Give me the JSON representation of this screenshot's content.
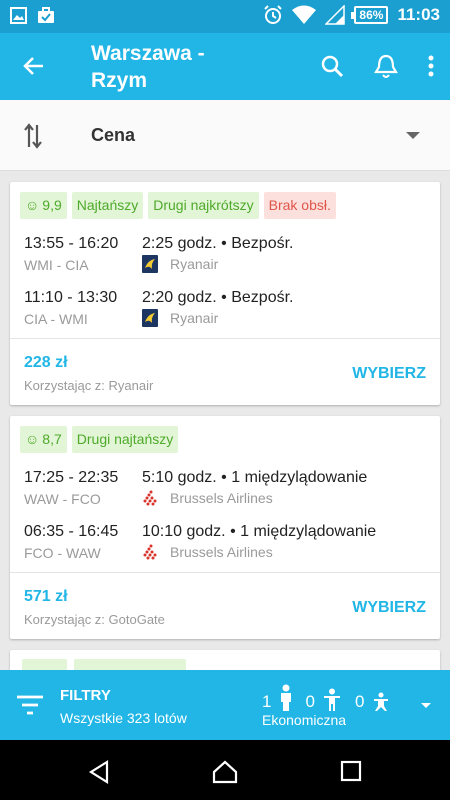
{
  "status": {
    "battery": "86%",
    "time": "11:03"
  },
  "appbar": {
    "title": "Warszawa - Rzym"
  },
  "sort": {
    "label": "Cena"
  },
  "results": [
    {
      "badges": [
        {
          "label": "9,9",
          "kind": "green",
          "smile": true
        },
        {
          "label": "Najtańszy",
          "kind": "green"
        },
        {
          "label": "Drugi najkrótszy",
          "kind": "green"
        },
        {
          "label": "Brak obsł.",
          "kind": "red"
        }
      ],
      "legs": [
        {
          "times": "13:55 - 16:20",
          "airports": "WMI - CIA",
          "duration": "2:25 godz. • Bezpośr.",
          "airline": "Ryanair"
        },
        {
          "times": "11:10 - 13:30",
          "airports": "CIA - WMI",
          "duration": "2:20 godz. • Bezpośr.",
          "airline": "Ryanair"
        }
      ],
      "price": "228 zł",
      "via": "Korzystając z: Ryanair",
      "select": "WYBIERZ"
    },
    {
      "badges": [
        {
          "label": "8,7",
          "kind": "green",
          "smile": true
        },
        {
          "label": "Drugi najtańszy",
          "kind": "green"
        }
      ],
      "legs": [
        {
          "times": "17:25 - 22:35",
          "airports": "WAW - FCO",
          "duration": "5:10 godz. • 1 międzylądowanie",
          "airline": "Brussels Airlines"
        },
        {
          "times": "06:35 - 16:45",
          "airports": "FCO - WAW",
          "duration": "10:10 godz. • 1 międzylądowanie",
          "airline": "Brussels Airlines"
        }
      ],
      "price": "571 zł",
      "via": "Korzystając z: GotoGate",
      "select": "WYBIERZ"
    }
  ],
  "bottombar": {
    "filter_title": "FILTRY",
    "filter_sub": "Wszystkie 323 lotów",
    "adults": "1",
    "children": "0",
    "infants": "0",
    "cabin": "Ekonomiczna"
  }
}
